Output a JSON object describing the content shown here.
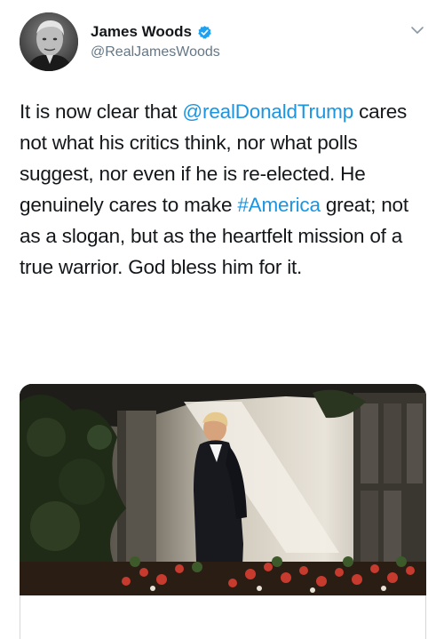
{
  "author": {
    "display_name": "James Woods",
    "handle": "@RealJamesWoods",
    "verified": true,
    "avatar_icon": "profile-photo",
    "verified_color": "#1da1f2"
  },
  "tweet": {
    "segments": [
      {
        "text": "It is now clear that ",
        "type": "text"
      },
      {
        "text": "@realDonaldTrump",
        "type": "mention"
      },
      {
        "text": " cares not what his critics think, nor what polls suggest, nor even if he is re-elected. He genuinely cares to make ",
        "type": "text"
      },
      {
        "text": "#America",
        "type": "hashtag"
      },
      {
        "text": " great; not as a slogan, but as the heartfelt mission of a true warrior. God bless him for it.",
        "type": "text"
      }
    ],
    "link_color": "#1b95e0"
  },
  "media": {
    "type": "photo",
    "icon": "photo-man-in-suit-walking-colonnade"
  },
  "menu": {
    "icon": "chevron-down-icon"
  }
}
